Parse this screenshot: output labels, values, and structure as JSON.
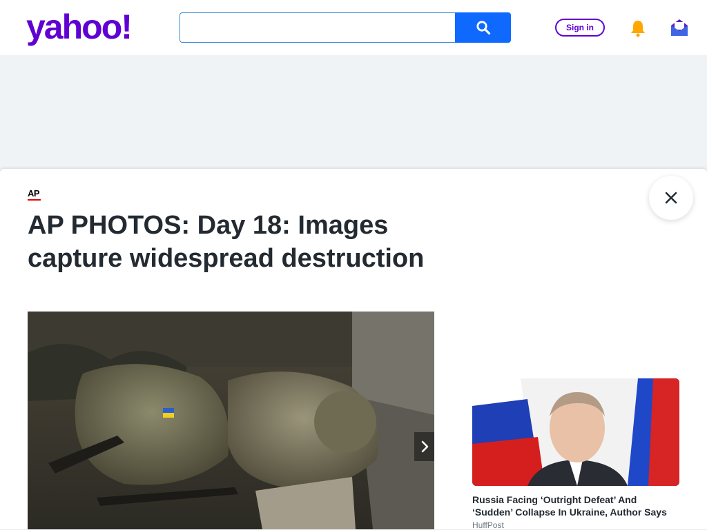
{
  "header": {
    "logo_text": "yahoo!",
    "search": {
      "value": "",
      "placeholder": ""
    },
    "signin_label": "Sign in"
  },
  "article": {
    "source_logo": "AP",
    "title": "AP PHOTOS: Day 18: Images capture widespread destruction"
  },
  "recommendation": {
    "title": "Russia Facing ‘Outright Defeat’ And ‘Sudden’ Collapse In Ukraine, Author Says",
    "source": "HuffPost"
  },
  "icons": {
    "search": "search-icon",
    "bell": "bell-icon",
    "mail": "mail-icon",
    "close": "close-icon",
    "next": "chevron-right-icon"
  },
  "colors": {
    "brand": "#6001d2",
    "search_button": "#0f69ff",
    "ap_red": "#e50000",
    "bell": "#ffa700",
    "page_bg": "#f0f3f5",
    "title_text": "#232a31"
  }
}
